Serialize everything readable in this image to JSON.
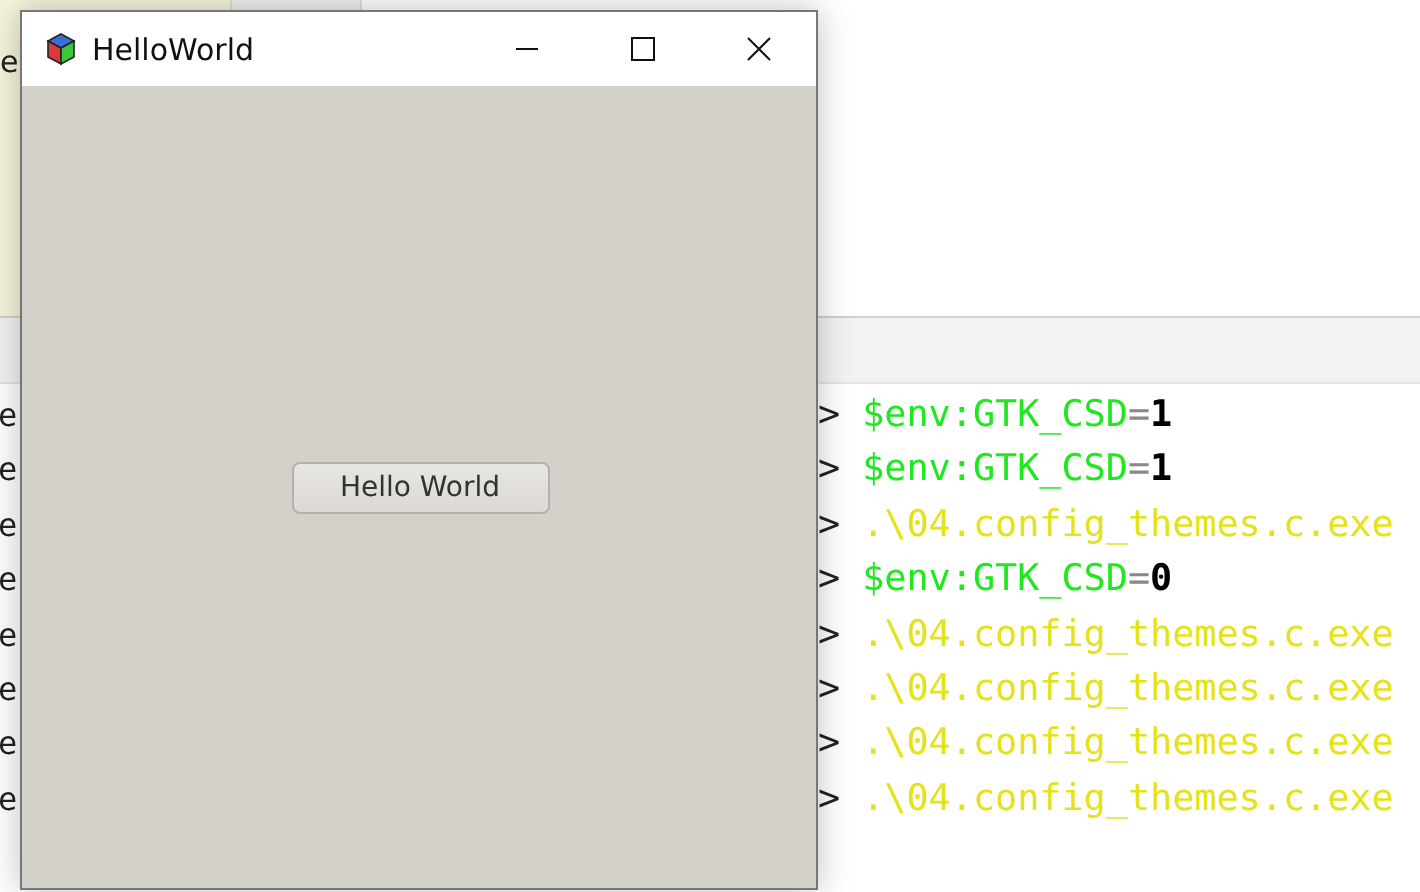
{
  "editor": {
    "side_text": "e"
  },
  "terminal": {
    "lines": [
      {
        "prompt_start": "e",
        "prompt_end": ">",
        "tokens": [
          {
            "kind": "variable",
            "text": "$env:GTK_CSD"
          },
          {
            "kind": "operator",
            "text": "="
          },
          {
            "kind": "number",
            "text": "1"
          }
        ]
      },
      {
        "prompt_start": "e",
        "prompt_end": ">",
        "tokens": [
          {
            "kind": "variable",
            "text": "$env:GTK_CSD"
          },
          {
            "kind": "operator",
            "text": "="
          },
          {
            "kind": "number",
            "text": "1"
          }
        ]
      },
      {
        "prompt_start": "e",
        "prompt_end": ">",
        "tokens": [
          {
            "kind": "path",
            "text": ".\\04.config_themes.c.exe"
          }
        ]
      },
      {
        "prompt_start": "e",
        "prompt_end": ">",
        "tokens": [
          {
            "kind": "variable",
            "text": "$env:GTK_CSD"
          },
          {
            "kind": "operator",
            "text": "="
          },
          {
            "kind": "number",
            "text": "0"
          }
        ]
      },
      {
        "prompt_start": "e",
        "prompt_end": ">",
        "tokens": [
          {
            "kind": "path",
            "text": ".\\04.config_themes.c.exe"
          }
        ]
      },
      {
        "prompt_start": "e",
        "prompt_end": ">",
        "tokens": [
          {
            "kind": "path",
            "text": ".\\04.config_themes.c.exe"
          }
        ]
      },
      {
        "prompt_start": "e",
        "prompt_end": ">",
        "tokens": [
          {
            "kind": "path",
            "text": ".\\04.config_themes.c.exe"
          }
        ]
      },
      {
        "prompt_start": "e",
        "prompt_end": ">",
        "tokens": [
          {
            "kind": "path",
            "text": ".\\04.config_themes.c.exe"
          }
        ]
      }
    ]
  },
  "window": {
    "title": "HelloWorld",
    "button": "Hello World"
  }
}
